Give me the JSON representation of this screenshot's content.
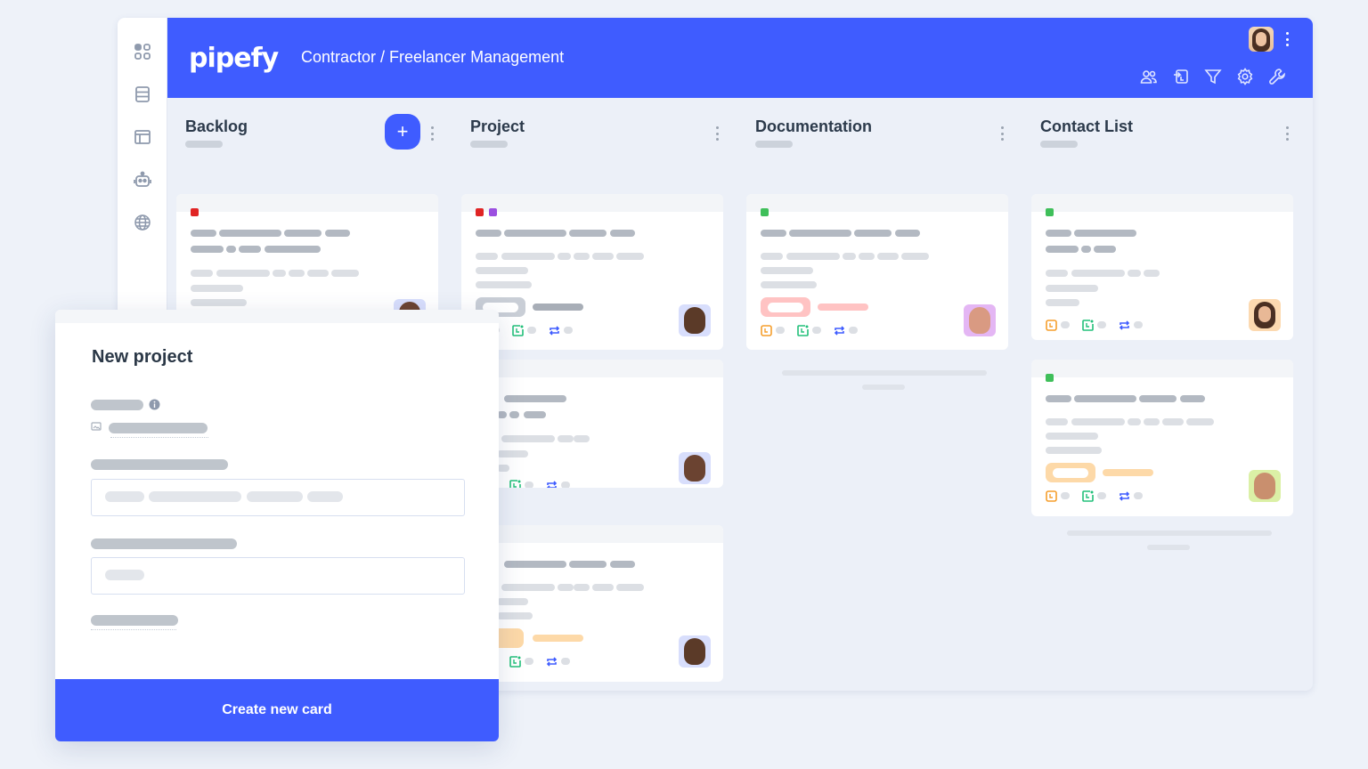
{
  "app": {
    "logo": "pipefy",
    "title": "Contractor / Freelancer Management",
    "brand_color": "#3f5cff"
  },
  "rail": {
    "items": [
      {
        "icon": "apps-grid-icon"
      },
      {
        "icon": "database-icon"
      },
      {
        "icon": "portal-layout-icon"
      },
      {
        "icon": "automation-robot-icon"
      },
      {
        "icon": "globe-icon"
      }
    ]
  },
  "toolbar": {
    "icons": [
      "members-icon",
      "import-icon",
      "filter-icon",
      "settings-gear-icon",
      "wrench-icon"
    ]
  },
  "columns": [
    {
      "title": "Backlog",
      "has_add_button": true,
      "add_label": "+",
      "cards": [
        {
          "tags": [
            "#e02424"
          ],
          "avatar_bg": "#d8defc",
          "face": "#6b4331"
        }
      ]
    },
    {
      "title": "Project",
      "cards": [
        {
          "tags": [
            "#e02424",
            "#9b4fe0"
          ],
          "label_color": "#c9ced6",
          "label_text_color": "#a8aeb7",
          "avatar_bg": "#d8defc",
          "face": "#5b3a28"
        },
        {
          "tags": [],
          "avatar_bg": "#d8defc",
          "face": "#6b4331"
        },
        {
          "tags": [],
          "label_color": "#fdd9a8",
          "label_text_color": "#fdd9a8",
          "avatar_bg": "#d8defc",
          "face": "#5b3a28"
        }
      ]
    },
    {
      "title": "Documentation",
      "cards": [
        {
          "tags": [
            "#3fbf5a"
          ],
          "label_color": "#ffc3c3",
          "label_text_color": "#ffc3c3",
          "avatar_bg": "#e4b6f4",
          "face": "#d99a82"
        }
      ]
    },
    {
      "title": "Contact List",
      "cards": [
        {
          "tags": [
            "#3fbf5a"
          ],
          "avatar_bg": "#fcd9b0",
          "face": "#e8b896"
        },
        {
          "tags": [
            "#3fbf5a"
          ],
          "label_color": "#fdd9a8",
          "label_text_color": "#fdd9a8",
          "avatar_bg": "#dbf0a6",
          "face": "#c98f6e"
        }
      ]
    }
  ],
  "modal": {
    "title": "New project",
    "info_icon": "info-icon",
    "field_icon": "image-field-icon",
    "submit_label": "Create new card"
  },
  "card_icon_colors": {
    "due": "#f59e2c",
    "age": "#22c07a",
    "recurrence": "#3f5cff"
  }
}
